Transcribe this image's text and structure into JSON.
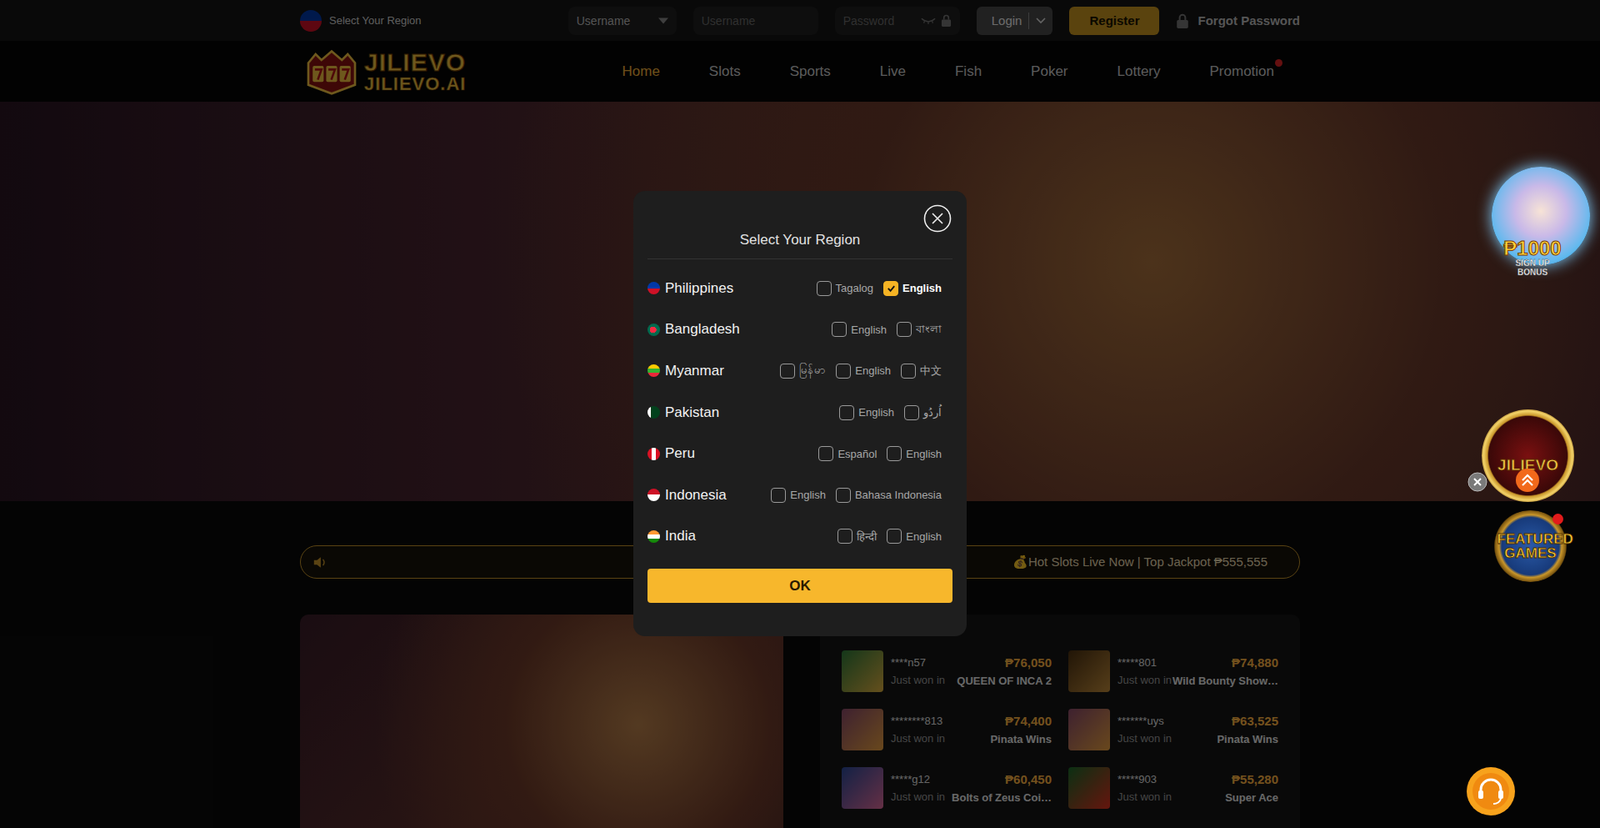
{
  "topbar": {
    "region_label": "Select Your Region",
    "username_select": "Username",
    "username_placeholder": "Username",
    "password_placeholder": "Password",
    "login": "Login",
    "register": "Register",
    "forgot": "Forgot Password"
  },
  "logo": {
    "line1": "JILIEVO",
    "line2": "JILIEVO.AI"
  },
  "nav": [
    {
      "label": "Home",
      "selected": true,
      "dot": false
    },
    {
      "label": "Slots",
      "selected": false,
      "dot": false
    },
    {
      "label": "Sports",
      "selected": false,
      "dot": false
    },
    {
      "label": "Live",
      "selected": false,
      "dot": false
    },
    {
      "label": "Fish",
      "selected": false,
      "dot": false
    },
    {
      "label": "Poker",
      "selected": false,
      "dot": false
    },
    {
      "label": "Lottery",
      "selected": false,
      "dot": false
    },
    {
      "label": "Promotion",
      "selected": false,
      "dot": true
    }
  ],
  "marquee": {
    "text": "💰Hot Slots Live Now | Top Jackpot ₱555,555"
  },
  "winners": [
    {
      "user": "****n57",
      "caption": "Just won in",
      "amount": "₱76,050",
      "game": "QUEEN OF INCA 2"
    },
    {
      "user": "*****801",
      "caption": "Just won in",
      "amount": "₱74,880",
      "game": "Wild Bounty Show…"
    },
    {
      "user": "********813",
      "caption": "Just won in",
      "amount": "₱74,400",
      "game": "Pinata Wins"
    },
    {
      "user": "*******uys",
      "caption": "Just won in",
      "amount": "₱63,525",
      "game": "Pinata Wins"
    },
    {
      "user": "*****g12",
      "caption": "Just won in",
      "amount": "₱60,450",
      "game": "Bolts of Zeus Coi…"
    },
    {
      "user": "*****903",
      "caption": "Just won in",
      "amount": "₱55,280",
      "game": "Super Ace"
    }
  ],
  "floating": {
    "bonus": {
      "amount": "₱1000",
      "label": "SIGN UP BONUS"
    },
    "logo_text": "JILIEVO",
    "featured": {
      "label": "FEATURED GAMES",
      "dot": true
    }
  },
  "modal": {
    "title": "Select Your Region",
    "regions": [
      {
        "country": "Philippines",
        "languages": [
          {
            "label": "Tagalog",
            "checked": false
          },
          {
            "label": "English",
            "checked": true
          }
        ]
      },
      {
        "country": "Bangladesh",
        "languages": [
          {
            "label": "English",
            "checked": false
          },
          {
            "label": "বাংলা",
            "checked": false
          }
        ]
      },
      {
        "country": "Myanmar",
        "languages": [
          {
            "label": "မြန်မာ",
            "checked": false
          },
          {
            "label": "English",
            "checked": false
          },
          {
            "label": "中文",
            "checked": false
          }
        ]
      },
      {
        "country": "Pakistan",
        "languages": [
          {
            "label": "English",
            "checked": false
          },
          {
            "label": "اُردُو",
            "checked": false
          }
        ]
      },
      {
        "country": "Peru",
        "languages": [
          {
            "label": "Español",
            "checked": false
          },
          {
            "label": "English",
            "checked": false
          }
        ]
      },
      {
        "country": "Indonesia",
        "languages": [
          {
            "label": "English",
            "checked": false
          },
          {
            "label": "Bahasa Indonesia",
            "checked": false
          }
        ]
      },
      {
        "country": "India",
        "languages": [
          {
            "label": "हिन्दी",
            "checked": false
          },
          {
            "label": "English",
            "checked": false
          }
        ]
      }
    ],
    "ok": "OK"
  }
}
